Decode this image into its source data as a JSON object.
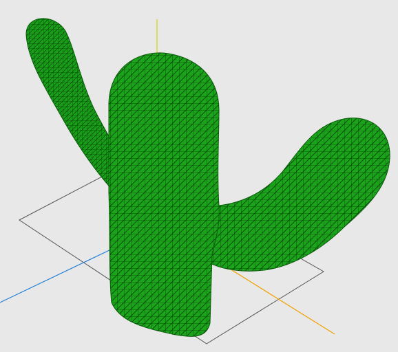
{
  "scene": {
    "background_color": "#e8e8e8",
    "object": {
      "name": "cactus-mesh",
      "fill_color": "#1aa41a",
      "wire_color": "#0b3d0b"
    },
    "axes": {
      "x_color": "#f0a000",
      "y_color": "#d6d600",
      "z_color": "#1f7fd6",
      "grid_color": "#444444"
    }
  }
}
